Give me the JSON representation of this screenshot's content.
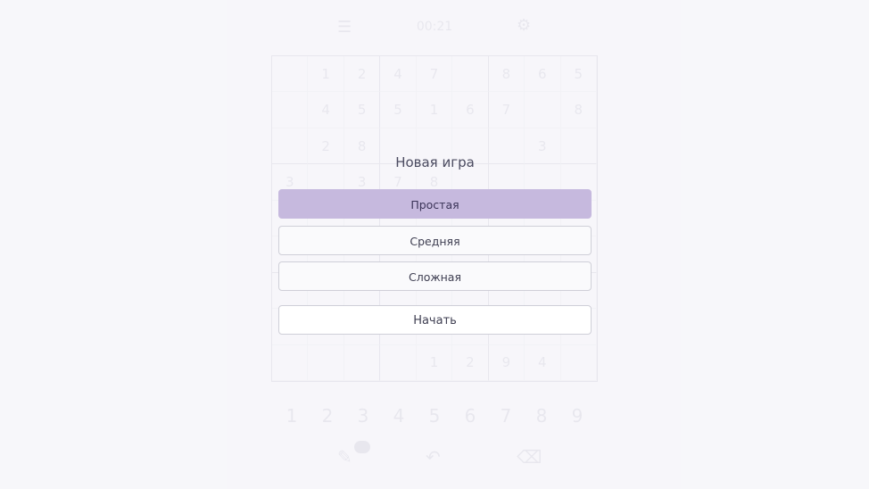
{
  "background": {
    "menu_icon": "menu-icon",
    "timer": "00:21",
    "settings_icon": "gear-icon",
    "grid": [
      [
        "",
        "1",
        "2",
        "4",
        "7",
        "",
        "8",
        "6",
        "5"
      ],
      [
        "",
        "4",
        "5",
        "5",
        "1",
        "6",
        "7",
        "",
        "8"
      ],
      [
        "",
        "2",
        "8",
        "",
        "",
        "",
        "",
        "3",
        ""
      ],
      [
        "3",
        "",
        "3",
        "7",
        "8",
        "",
        "",
        "",
        ""
      ],
      [
        "",
        "",
        "",
        "",
        "",
        "",
        "",
        "",
        ""
      ],
      [
        "",
        "",
        "",
        "",
        "",
        "",
        "",
        "",
        ""
      ],
      [
        "",
        "",
        "",
        "",
        "",
        "",
        "",
        "",
        ""
      ],
      [
        "",
        "",
        "",
        "",
        "",
        "",
        "",
        "",
        ""
      ],
      [
        "",
        "",
        "",
        "",
        "1",
        "2",
        "9",
        "4",
        ""
      ]
    ],
    "numpad": [
      "1",
      "2",
      "3",
      "4",
      "5",
      "6",
      "7",
      "8",
      "9"
    ],
    "tools": [
      "hint-icon",
      "undo-icon",
      "erase-icon"
    ]
  },
  "dialog": {
    "title": "Новая игра",
    "options": [
      "Простая",
      "Средняя",
      "Сложная"
    ],
    "selected_index": 0,
    "start_label": "Начать"
  },
  "colors": {
    "accent": "#c6b9de",
    "background": "#f3f2f8",
    "text": "#4b4b60"
  }
}
